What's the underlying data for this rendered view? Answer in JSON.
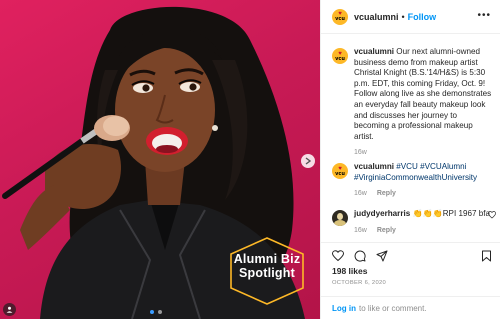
{
  "post": {
    "username": "vcualumni",
    "follow_label": "Follow",
    "more_label": "•••",
    "overlay_title": "Alumni Biz",
    "overlay_subtitle": "Spotlight"
  },
  "avatar": {
    "heart": "♥",
    "text": "vcu"
  },
  "comments": [
    {
      "username": "vcualumni",
      "text": "Our next alumni-owned business demo from makeup artist Christal Knight (B.S.'14/H&S) is 5:30 p.m. EDT, this coming Friday, Oct. 9! Follow along live as she demonstrates an everyday fall beauty makeup look and discusses her journey to becoming a professional makeup artist.",
      "time": "16w",
      "reply": ""
    },
    {
      "username": "vcualumni",
      "text": "#VCU #VCUAlumni #VirginiaCommonwealthUniversity",
      "time": "16w",
      "reply": "Reply"
    },
    {
      "username": "judydyerharris",
      "text": "👏👏👏RPI 1967 bfa",
      "time": "16w",
      "reply": "Reply"
    }
  ],
  "actions": {
    "likes": "198 likes",
    "date": "OCTOBER 6, 2020",
    "login_link": "Log in",
    "login_rest": "to like or comment."
  },
  "colors": {
    "accent": "#0095f6",
    "vcu_gold": "#fdb827",
    "background_pink": "#c81a55"
  },
  "icons": [
    "heart-icon",
    "comment-icon",
    "share-icon",
    "bookmark-icon",
    "more-icon",
    "chevron-right-icon"
  ]
}
